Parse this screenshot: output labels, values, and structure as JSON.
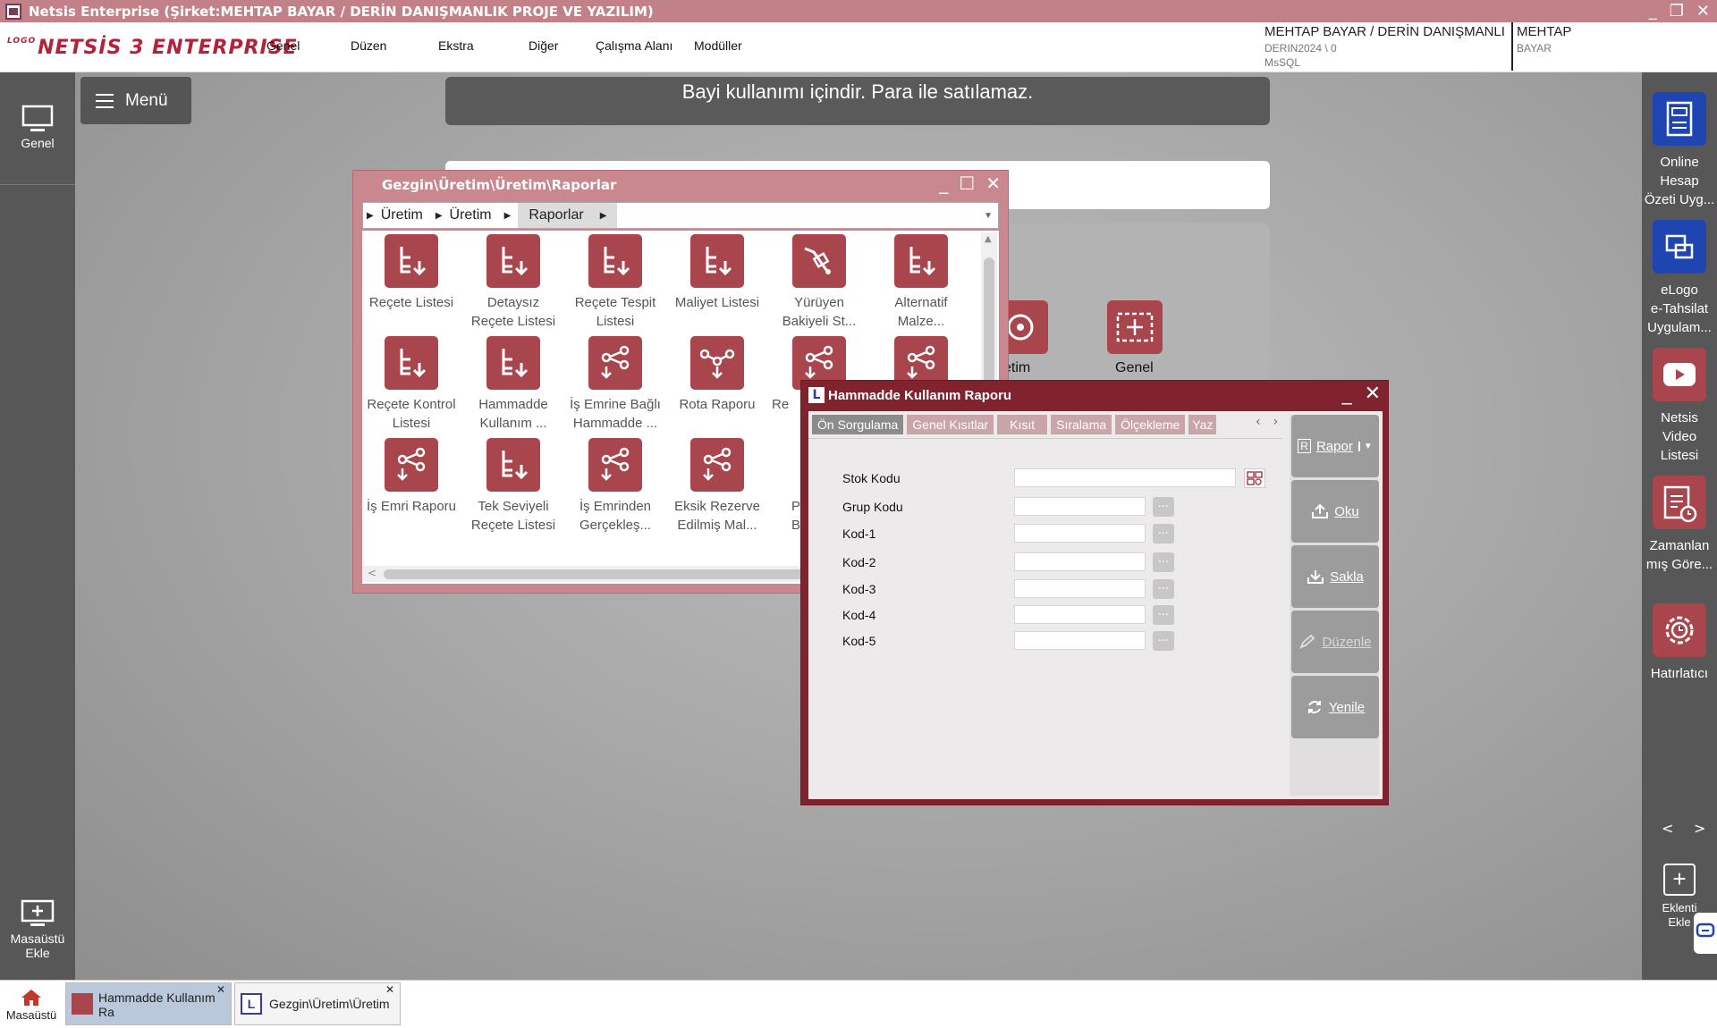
{
  "window": {
    "title": "Netsis Enterprise (Şirket:MEHTAP BAYAR / DERİN DANIŞMANLIK PROJE VE YAZILIM)"
  },
  "logo": {
    "prefix": "LOGO",
    "text": "NETSİS 3 ENTERPRISE"
  },
  "menu": [
    "Genel",
    "Düzen",
    "Ekstra",
    "Diğer",
    "Çalışma Alanı",
    "Modüller"
  ],
  "user": {
    "company": "MEHTAP BAYAR / DERİN DANIŞMANLI",
    "db": "DERIN2024 \\ 0",
    "engine": "MsSQL",
    "name": "MEHTAP",
    "surname": "BAYAR"
  },
  "leftbar": {
    "genel": "Genel",
    "masaustu_ekle_1": "Masaüstü",
    "masaustu_ekle_2": "Ekle"
  },
  "menu_button": "Menü",
  "banner": "Bayi kullanımı içindir. Para ile satılamaz.",
  "bg_icons": [
    "etim",
    "Genel"
  ],
  "rightbar": {
    "items": [
      {
        "l1": "Online",
        "l2": "Hesap",
        "l3": "Özeti Uyg..."
      },
      {
        "l1": "eLogo",
        "l2": "e-Tahsilat",
        "l3": "Uygulam..."
      },
      {
        "l1": "Netsis",
        "l2": "Video",
        "l3": "Listesi"
      },
      {
        "l1": "Zamanlan",
        "l2": "mış Göre...",
        "l3": ""
      },
      {
        "l1": "Hatırlatıcı",
        "l2": "",
        "l3": ""
      }
    ],
    "nav_prev": "<",
    "nav_next": ">",
    "eklenti_1": "Eklenti",
    "eklenti_2": "Ekle"
  },
  "explorer": {
    "title": "Gezgin\\Üretim\\Üretim\\Raporlar",
    "crumbs": [
      "Üretim",
      "Üretim",
      "Raporlar"
    ],
    "items": [
      {
        "l1": "Reçete Listesi",
        "l2": ""
      },
      {
        "l1": "Detaysız",
        "l2": "Reçete Listesi"
      },
      {
        "l1": "Reçete Tespit",
        "l2": "Listesi"
      },
      {
        "l1": "Maliyet Listesi",
        "l2": ""
      },
      {
        "l1": "Yürüyen",
        "l2": "Bakiyeli St..."
      },
      {
        "l1": "Alternatif",
        "l2": "Malze..."
      },
      {
        "l1": "Reçete Kontrol",
        "l2": "Listesi"
      },
      {
        "l1": "Hammadde",
        "l2": "Kullanım ..."
      },
      {
        "l1": "İş Emrine Bağlı",
        "l2": "Hammadde ..."
      },
      {
        "l1": "Rota Raporu",
        "l2": ""
      },
      {
        "l1": "Re",
        "l2": ""
      },
      {
        "l1": "",
        "l2": ""
      },
      {
        "l1": "İş Emri Raporu",
        "l2": ""
      },
      {
        "l1": "Tek Seviyeli",
        "l2": "Reçete Listesi"
      },
      {
        "l1": "İş Emrinden",
        "l2": "Gerçekleş..."
      },
      {
        "l1": "Eksik Rezerve",
        "l2": "Edilmiş Mal..."
      },
      {
        "l1": "P",
        "l2": "B"
      }
    ]
  },
  "dialog": {
    "title": "Hammadde Kullanım Raporu",
    "tabs": [
      "Ön Sorgulama",
      "Genel Kısıtlar",
      "Kısıt",
      "Sıralama",
      "Ölçekleme",
      "Yaz"
    ],
    "fields": [
      {
        "label": "Stok Kodu",
        "value": ""
      },
      {
        "label": "Grup Kodu",
        "value": ""
      },
      {
        "label": "Kod-1",
        "value": ""
      },
      {
        "label": "Kod-2",
        "value": ""
      },
      {
        "label": "Kod-3",
        "value": ""
      },
      {
        "label": "Kod-4",
        "value": ""
      },
      {
        "label": "Kod-5",
        "value": ""
      }
    ],
    "lookup_btn": "...",
    "buttons": {
      "rapor": "Rapor",
      "oku": "Oku",
      "sakla": "Sakla",
      "duzenle": "Düzenle",
      "yenile": "Yenile"
    }
  },
  "taskbar": {
    "home": "Masaüstü",
    "task1_l1": "Hammadde Kullanım",
    "task1_l2": "Ra",
    "task2": "Gezgin\\Üretim\\Üretim"
  },
  "colors": {
    "accent": "#a8454d",
    "dialog_frame": "#80232e",
    "title_bar": "#c28088"
  }
}
